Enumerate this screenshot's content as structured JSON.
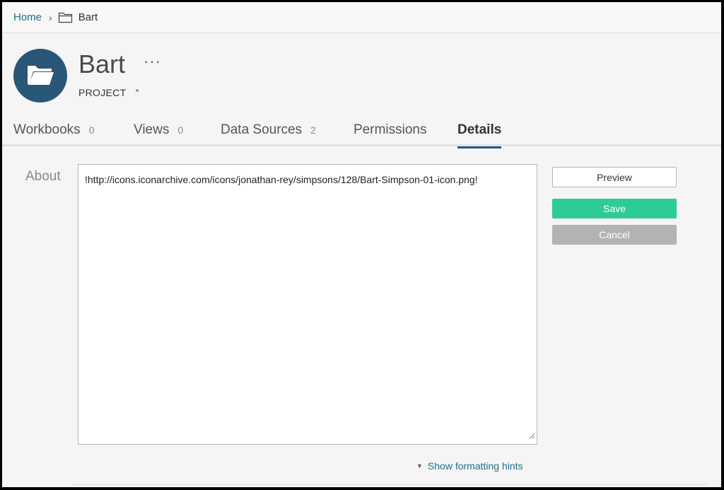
{
  "breadcrumb": {
    "home": "Home",
    "separator": "›",
    "folder_icon": "folder-outline-icon",
    "current": "Bart"
  },
  "project": {
    "title": "Bart",
    "more": "···",
    "type": "PROJECT",
    "avatar_icon": "folder-icon",
    "avatar_color": "#2a5677"
  },
  "tabs": [
    {
      "label": "Workbooks",
      "count": "0"
    },
    {
      "label": "Views",
      "count": "0"
    },
    {
      "label": "Data Sources",
      "count": "2"
    },
    {
      "label": "Permissions",
      "count": ""
    },
    {
      "label": "Details",
      "count": "",
      "active": true
    }
  ],
  "details": {
    "about_label": "About",
    "about_value": "!http://icons.iconarchive.com/icons/jonathan-rey/simpsons/128/Bart-Simpson-01-icon.png!",
    "preview_label": "Preview",
    "save_label": "Save",
    "cancel_label": "Cancel",
    "hints_label": "Show formatting hints",
    "save_color": "#2ecc94",
    "cancel_color": "#b3b3b3",
    "link_color": "#1f6f8b"
  }
}
